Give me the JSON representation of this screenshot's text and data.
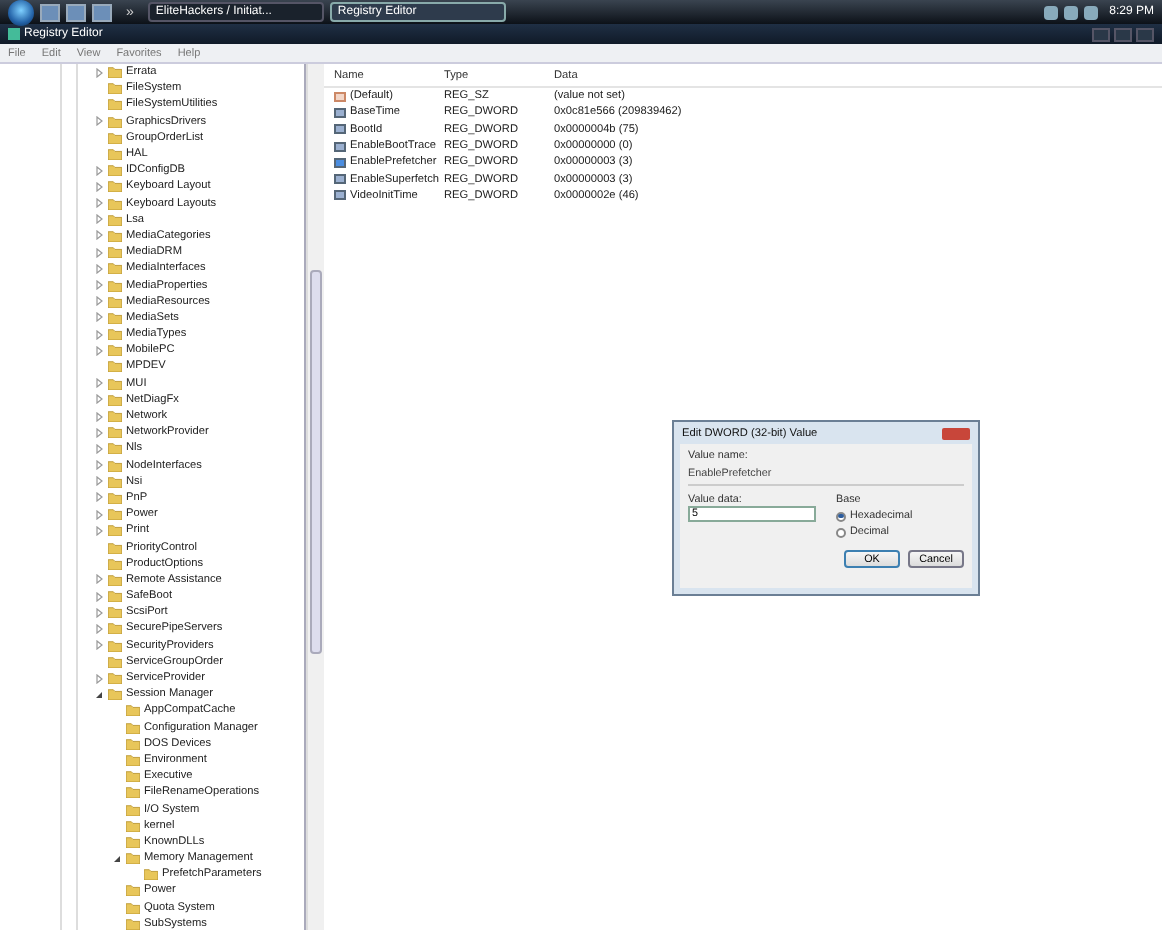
{
  "taskbar": {
    "overflow": "»",
    "tasks": [
      {
        "label": "EliteHackers / Initiat...",
        "selected": false
      },
      {
        "label": "Registry Editor",
        "selected": true
      }
    ],
    "clock": "8:29 PM"
  },
  "window": {
    "title": "Registry Editor"
  },
  "menu": [
    "File",
    "Edit",
    "View",
    "Favorites",
    "Help"
  ],
  "tree": [
    {
      "label": "Errata",
      "expandable": true
    },
    {
      "label": "FileSystem",
      "expandable": false
    },
    {
      "label": "FileSystemUtilities",
      "expandable": false
    },
    {
      "label": "GraphicsDrivers",
      "expandable": true
    },
    {
      "label": "GroupOrderList",
      "expandable": false
    },
    {
      "label": "HAL",
      "expandable": false
    },
    {
      "label": "IDConfigDB",
      "expandable": true
    },
    {
      "label": "Keyboard Layout",
      "expandable": true
    },
    {
      "label": "Keyboard Layouts",
      "expandable": true
    },
    {
      "label": "Lsa",
      "expandable": true
    },
    {
      "label": "MediaCategories",
      "expandable": true
    },
    {
      "label": "MediaDRM",
      "expandable": true
    },
    {
      "label": "MediaInterfaces",
      "expandable": true
    },
    {
      "label": "MediaProperties",
      "expandable": true
    },
    {
      "label": "MediaResources",
      "expandable": true
    },
    {
      "label": "MediaSets",
      "expandable": true
    },
    {
      "label": "MediaTypes",
      "expandable": true
    },
    {
      "label": "MobilePC",
      "expandable": true
    },
    {
      "label": "MPDEV",
      "expandable": false
    },
    {
      "label": "MUI",
      "expandable": true
    },
    {
      "label": "NetDiagFx",
      "expandable": true
    },
    {
      "label": "Network",
      "expandable": true
    },
    {
      "label": "NetworkProvider",
      "expandable": true
    },
    {
      "label": "Nls",
      "expandable": true
    },
    {
      "label": "NodeInterfaces",
      "expandable": true
    },
    {
      "label": "Nsi",
      "expandable": true
    },
    {
      "label": "PnP",
      "expandable": true
    },
    {
      "label": "Power",
      "expandable": true
    },
    {
      "label": "Print",
      "expandable": true
    },
    {
      "label": "PriorityControl",
      "expandable": false
    },
    {
      "label": "ProductOptions",
      "expandable": false
    },
    {
      "label": "Remote Assistance",
      "expandable": true
    },
    {
      "label": "SafeBoot",
      "expandable": true
    },
    {
      "label": "ScsiPort",
      "expandable": true
    },
    {
      "label": "SecurePipeServers",
      "expandable": true
    },
    {
      "label": "SecurityProviders",
      "expandable": true
    },
    {
      "label": "ServiceGroupOrder",
      "expandable": false
    },
    {
      "label": "ServiceProvider",
      "expandable": true
    },
    {
      "label": "Session Manager",
      "expanded": true,
      "children": [
        {
          "label": "AppCompatCache",
          "expandable": false
        },
        {
          "label": "Configuration Manager",
          "expandable": false
        },
        {
          "label": "DOS Devices",
          "expandable": false
        },
        {
          "label": "Environment",
          "expandable": false
        },
        {
          "label": "Executive",
          "expandable": false
        },
        {
          "label": "FileRenameOperations",
          "expandable": false
        },
        {
          "label": "I/O System",
          "expandable": false
        },
        {
          "label": "kernel",
          "expandable": false
        },
        {
          "label": "KnownDLLs",
          "expandable": false
        },
        {
          "label": "Memory Management",
          "expanded": true,
          "children": [
            {
              "label": "PrefetchParameters",
              "expandable": false
            }
          ]
        },
        {
          "label": "Power",
          "expandable": false
        },
        {
          "label": "Quota System",
          "expandable": false
        },
        {
          "label": "SubSystems",
          "expandable": false
        }
      ]
    }
  ],
  "values": {
    "columns": [
      "Name",
      "Type",
      "Data"
    ],
    "rows": [
      {
        "kind": "string",
        "name": "(Default)",
        "type": "REG_SZ",
        "data": "(value not set)",
        "selected": false
      },
      {
        "kind": "binary",
        "name": "BaseTime",
        "type": "REG_DWORD",
        "data": "0x0c81e566 (209839462)",
        "selected": false
      },
      {
        "kind": "binary",
        "name": "BootId",
        "type": "REG_DWORD",
        "data": "0x0000004b (75)",
        "selected": false
      },
      {
        "kind": "binary",
        "name": "EnableBootTrace",
        "type": "REG_DWORD",
        "data": "0x00000000 (0)",
        "selected": false
      },
      {
        "kind": "binary",
        "name": "EnablePrefetcher",
        "type": "REG_DWORD",
        "data": "0x00000003 (3)",
        "selected": true
      },
      {
        "kind": "binary",
        "name": "EnableSuperfetch",
        "type": "REG_DWORD",
        "data": "0x00000003 (3)",
        "selected": false
      },
      {
        "kind": "binary",
        "name": "VideoInitTime",
        "type": "REG_DWORD",
        "data": "0x0000002e (46)",
        "selected": false
      }
    ]
  },
  "dialog": {
    "title": "Edit DWORD (32-bit) Value",
    "value_name_label": "Value name:",
    "value_name": "EnablePrefetcher",
    "value_data_label": "Value data:",
    "value_data": "5",
    "base_label": "Base",
    "bases": [
      {
        "label": "Hexadecimal",
        "selected": true
      },
      {
        "label": "Decimal",
        "selected": false
      }
    ],
    "buttons": [
      "OK",
      "Cancel"
    ]
  }
}
